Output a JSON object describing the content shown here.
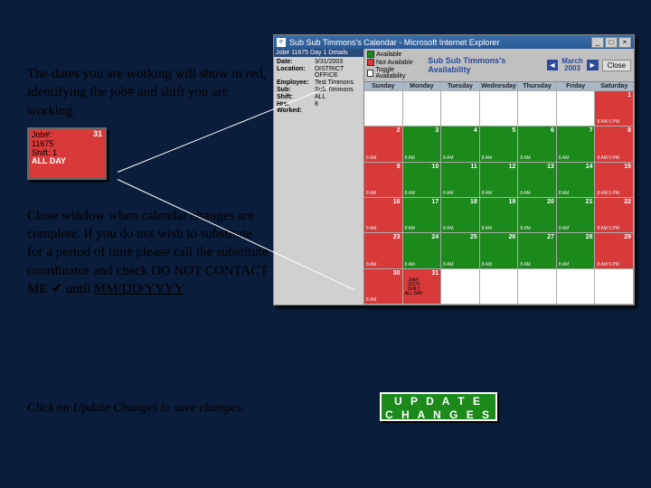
{
  "instructions": {
    "para1": "The dates you are working will show in red, identifying the job# and shift you are working.",
    "para2_a": "Close window when calendar changes are complete.  If you do not wish to substitute for a period of time please call the substitute coordinator and check DO NOT CONTACT ME ",
    "para2_b": " until ",
    "para2_date": "MM/DD/YYYY",
    "footer": "Click on Update Changes to save changes."
  },
  "thumb": {
    "job_lbl": "Job#:",
    "job_no": "11675",
    "shift_lbl": "Shift: 1",
    "allday": "ALL DAY",
    "date": "31"
  },
  "update_btn": "U P D A T E\nC H A N G E S",
  "browser": {
    "title": "Sub Sub Timmons's Calendar - Microsoft Internet Explorer",
    "details": {
      "title": "Job# 11675 Day 1 Details",
      "rows": [
        {
          "k": "Date:",
          "v": "3/31/2003"
        },
        {
          "k": "Location:",
          "v": "DISTRICT OFFICE"
        },
        {
          "k": "Employee:",
          "v": "Test Timmons"
        },
        {
          "k": "Sub:",
          "v": "Sub Timmons"
        },
        {
          "k": "Shift:",
          "v": "ALL"
        },
        {
          "k": "Hrs. Worked:",
          "v": "8"
        }
      ]
    },
    "legend": {
      "available": "Available",
      "not_available": "Not Available",
      "toggle": "Toggle Availability",
      "cal_title": "Sub Sub Timmons's Availability",
      "month": "March",
      "year": "2003",
      "close": "Close"
    },
    "days": [
      "Sunday",
      "Monday",
      "Tuesday",
      "Wednesday",
      "Thursday",
      "Friday",
      "Saturday"
    ],
    "cells": [
      [
        null,
        null,
        null,
        null,
        null,
        null,
        {
          "n": 1,
          "c": "r",
          "t": "8 AM  5 PM"
        }
      ],
      [
        {
          "n": 2,
          "c": "r",
          "t": "8 AM"
        },
        {
          "n": 3,
          "c": "g",
          "t": "8 AM"
        },
        {
          "n": 4,
          "c": "g",
          "t": "8 AM"
        },
        {
          "n": 5,
          "c": "g",
          "t": "8 AM"
        },
        {
          "n": 6,
          "c": "g",
          "t": "8 AM"
        },
        {
          "n": 7,
          "c": "g",
          "t": "8 AM"
        },
        {
          "n": 8,
          "c": "r",
          "t": "8 AM  5 PM"
        }
      ],
      [
        {
          "n": 9,
          "c": "r",
          "t": "8 AM"
        },
        {
          "n": 10,
          "c": "g",
          "t": "8 AM"
        },
        {
          "n": 11,
          "c": "g",
          "t": "8 AM"
        },
        {
          "n": 12,
          "c": "g",
          "t": "8 AM"
        },
        {
          "n": 13,
          "c": "g",
          "t": "8 AM"
        },
        {
          "n": 14,
          "c": "g",
          "t": "8 AM"
        },
        {
          "n": 15,
          "c": "r",
          "t": "8 AM  5 PM"
        }
      ],
      [
        {
          "n": 16,
          "c": "r",
          "t": "8 AM"
        },
        {
          "n": 17,
          "c": "g",
          "t": "8 AM"
        },
        {
          "n": 18,
          "c": "g",
          "t": "8 AM"
        },
        {
          "n": 19,
          "c": "g",
          "t": "8 AM"
        },
        {
          "n": 20,
          "c": "g",
          "t": "8 AM"
        },
        {
          "n": 21,
          "c": "g",
          "t": "8 AM"
        },
        {
          "n": 22,
          "c": "r",
          "t": "8 AM  5 PM"
        }
      ],
      [
        {
          "n": 23,
          "c": "r",
          "t": "8 AM"
        },
        {
          "n": 24,
          "c": "g",
          "t": "8 AM"
        },
        {
          "n": 25,
          "c": "g",
          "t": "8 AM"
        },
        {
          "n": 26,
          "c": "g",
          "t": "8 AM"
        },
        {
          "n": 27,
          "c": "g",
          "t": "8 AM"
        },
        {
          "n": 28,
          "c": "g",
          "t": "8 AM"
        },
        {
          "n": 29,
          "c": "r",
          "t": "8 AM  5 PM"
        }
      ],
      [
        {
          "n": 30,
          "c": "r",
          "t": "8 AM"
        },
        {
          "n": 31,
          "c": "r",
          "t": "",
          "job": "Job#:\n11675\nShift:1\nALL DAY"
        },
        null,
        null,
        null,
        null,
        null
      ]
    ]
  }
}
